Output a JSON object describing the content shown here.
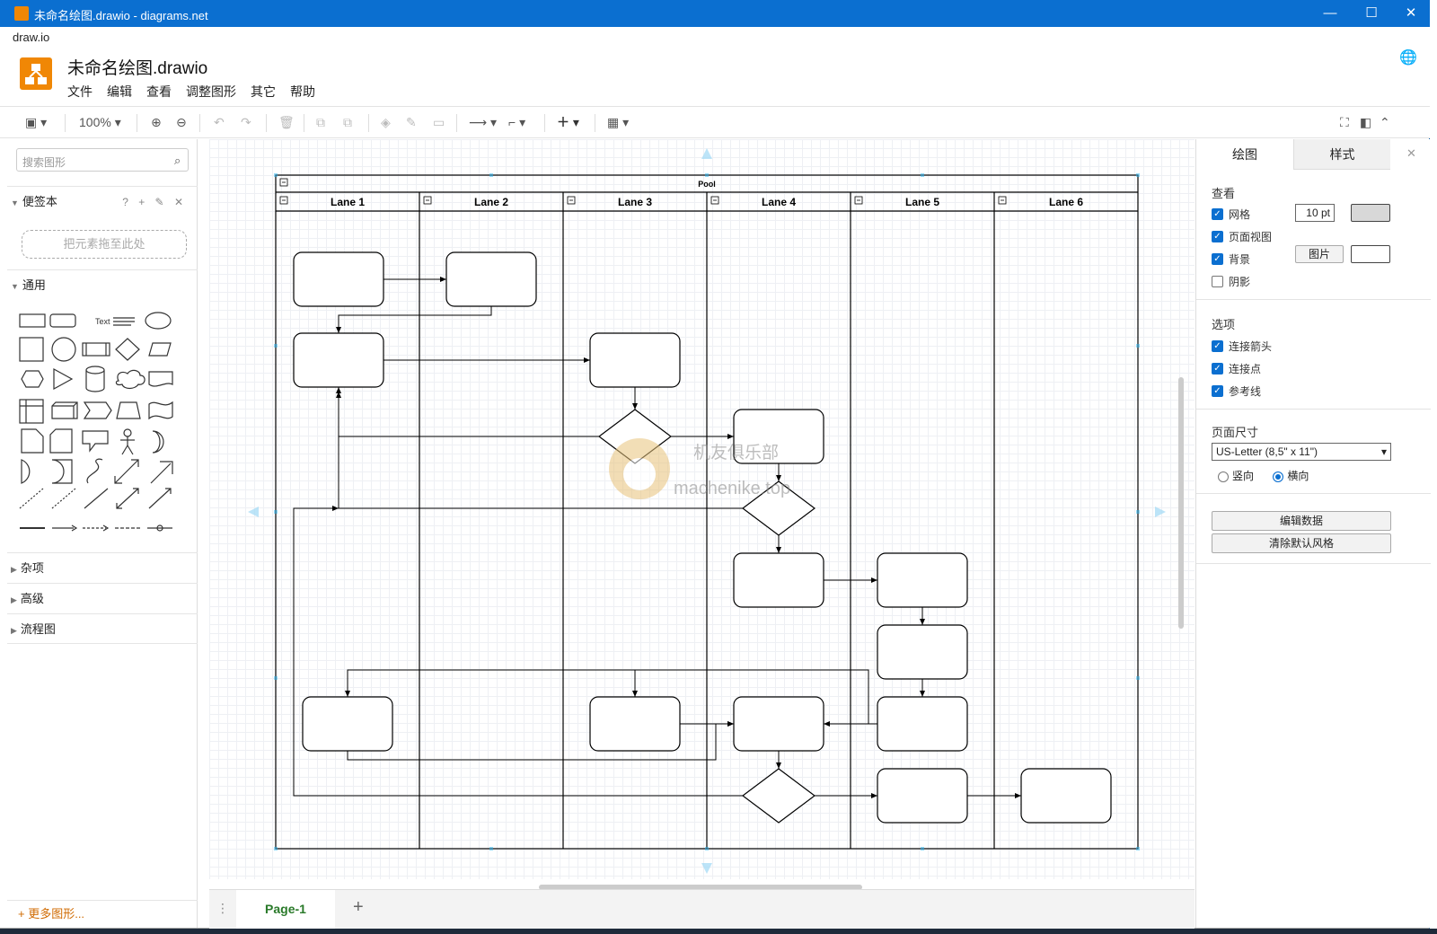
{
  "window": {
    "title": "未命名绘图.drawio - diagrams.net",
    "app_name": "draw.io",
    "file_title": "未命名绘图.drawio",
    "minimize": "—",
    "maximize": "☐",
    "close": "✕"
  },
  "menu": [
    "文件",
    "编辑",
    "查看",
    "调整图形",
    "其它",
    "帮助"
  ],
  "toolbar": {
    "zoom": "100%"
  },
  "left": {
    "search_placeholder": "搜索图形",
    "scratchpad": "便签本",
    "scratch_tools": "? + ✎ ✕",
    "dropzone": "把元素拖至此处",
    "general": "通用",
    "misc": "杂项",
    "advanced": "高级",
    "flowchart": "流程图",
    "more_shapes": "+ 更多图形..."
  },
  "pages": {
    "tab": "Page-1",
    "add": "+"
  },
  "right": {
    "tab_diagram": "绘图",
    "tab_style": "样式",
    "close": "✕",
    "view_heading": "查看",
    "grid": "网格",
    "grid_size": "10 pt",
    "page_view": "页面视图",
    "background": "背景",
    "image_button": "图片",
    "shadow": "阴影",
    "options_heading": "选项",
    "connection_arrows": "连接箭头",
    "connection_points": "连接点",
    "guides": "参考线",
    "page_size_heading": "页面尺寸",
    "page_size_value": "US-Letter (8,5\" x 11\")",
    "portrait": "竖向",
    "landscape": "横向",
    "edit_data": "编辑数据",
    "clear_style": "清除默认风格"
  },
  "diagram": {
    "pool": "Pool",
    "lanes": [
      "Lane 1",
      "Lane 2",
      "Lane 3",
      "Lane 4",
      "Lane 5",
      "Lane 6"
    ]
  },
  "watermark": {
    "line1": "机友俱乐部",
    "line2": "machenike.top"
  },
  "colors": {
    "titlebar": "#0b6fd0",
    "logo": "#f08705",
    "page_tab_text": "#2a7a2a"
  }
}
